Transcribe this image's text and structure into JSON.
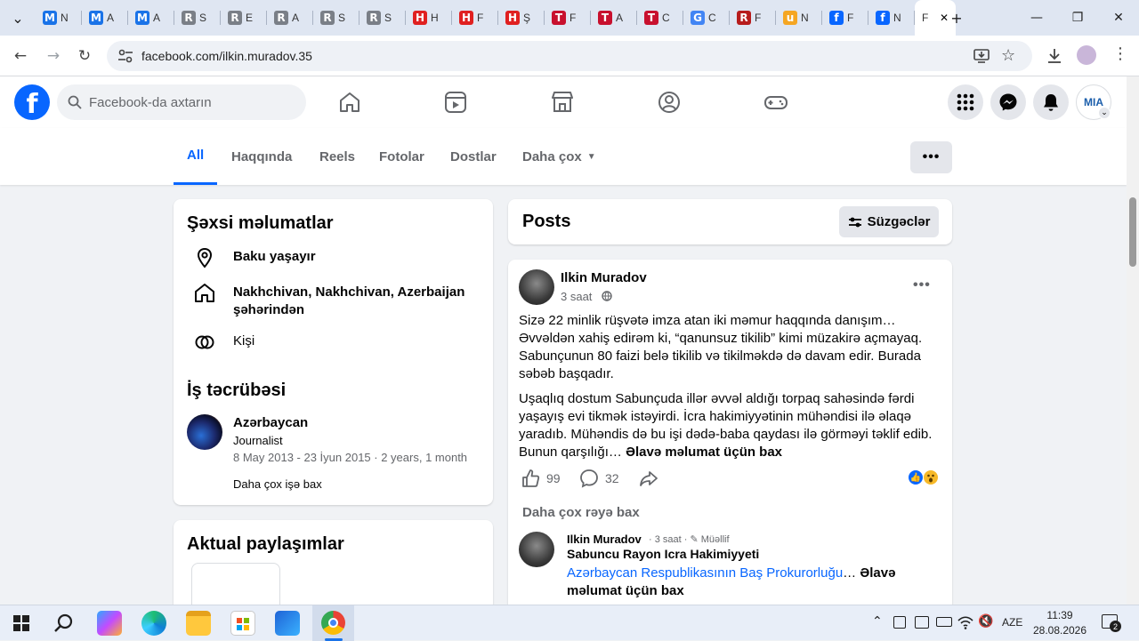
{
  "browser": {
    "tabs": [
      {
        "glyph": "M",
        "title": "N",
        "color": "#1a73e8"
      },
      {
        "glyph": "M",
        "title": "A",
        "color": "#1a73e8"
      },
      {
        "glyph": "M",
        "title": "A",
        "color": "#1a73e8"
      },
      {
        "glyph": "R",
        "title": "S",
        "color": "#7a7f87"
      },
      {
        "glyph": "R",
        "title": "E",
        "color": "#7a7f87"
      },
      {
        "glyph": "R",
        "title": "A",
        "color": "#7a7f87"
      },
      {
        "glyph": "R",
        "title": "S",
        "color": "#7a7f87"
      },
      {
        "glyph": "R",
        "title": "S",
        "color": "#7a7f87"
      },
      {
        "glyph": "H",
        "title": "H",
        "color": "#e02020"
      },
      {
        "glyph": "H",
        "title": "F",
        "color": "#e02020"
      },
      {
        "glyph": "H",
        "title": "Ş",
        "color": "#e02020"
      },
      {
        "glyph": "T",
        "title": "F",
        "color": "#c8102e"
      },
      {
        "glyph": "T",
        "title": "A",
        "color": "#c8102e"
      },
      {
        "glyph": "T",
        "title": "C",
        "color": "#c8102e"
      },
      {
        "glyph": "G",
        "title": "C",
        "color": "#4285f4"
      },
      {
        "glyph": "R",
        "title": "F",
        "color": "#b71c1c"
      },
      {
        "glyph": "u",
        "title": "N",
        "color": "#f5a623"
      },
      {
        "glyph": "f",
        "title": "F",
        "color": "#0866ff"
      },
      {
        "glyph": "f",
        "title": "N",
        "color": "#0866ff"
      }
    ],
    "active_tab_title": "F",
    "url": "facebook.com/ilkin.muradov.35"
  },
  "fb": {
    "search_placeholder": "Facebook-da axtarın",
    "avatar_text": "MIA"
  },
  "profile_tabs": {
    "all": "All",
    "about": "Haqqında",
    "reels": "Reels",
    "photos": "Fotolar",
    "friends": "Dostlar",
    "more": "Daha çox"
  },
  "personal": {
    "title": "Şəxsi məlumatlar",
    "lives": "Baku yaşayır",
    "from": "Nakhchivan, Nakhchivan, Azerbaijan şəhərindən",
    "gender": "Kişi",
    "work_title": "İş təcrübəsi",
    "work_org": "Azərbaycan",
    "work_role": "Journalist",
    "work_dates": "8 May 2013 - 23 İyun 2015 · 2 years, 1 month",
    "work_more": "Daha çox işə bax",
    "featured_title": "Aktual paylaşımlar"
  },
  "posts": {
    "title": "Posts",
    "filter_label": "Süzgəclər",
    "author": "Ilkin Muradov",
    "time": "3 saat",
    "para1": "Sizə 22 minlik rüşvətə imza atan iki məmur haqqında danışım… Əvvəldən xahiş edirəm ki, “qanunsuz tikilib” kimi müzakirə açmayaq. Sabunçunun 80 faizi belə tikilib və tikilməkdə də davam edir. Burada səbəb başqadır.",
    "para2": "Uşaqlıq dostum Sabunçuda illər əvvəl aldığı torpaq sahəsində fərdi yaşayış evi tikmək istəyirdi. İcra hakimiyyətinin mühəndisi ilə əlaqə yaradıb. Mühəndis də bu işi dədə-baba qaydası ilə görməyi təklif edib. Bunun qarşılığı…",
    "see_more": "Əlavə məlumat üçün bax",
    "likes": "99",
    "comments": "32",
    "more_comments": "Daha çox rəyə bax",
    "c_author": "Ilkin Muradov",
    "c_time": "3 saat",
    "c_badge": "Müəllif",
    "c_line1": "Sabuncu Rayon Icra Hakimiyyeti",
    "c_link": "Azərbaycan Respublikasının Baş Prokurorluğu",
    "c_more": "Əlavə məlumat üçün bax"
  },
  "taskbar": {
    "lang": "AZE",
    "time": "11:39",
    "date": "28.08.2026",
    "notif_count": "2"
  }
}
